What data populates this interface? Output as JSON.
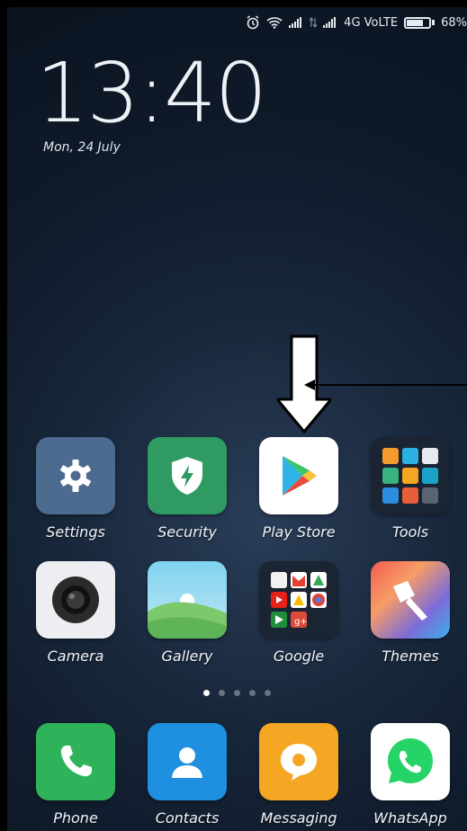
{
  "status_bar": {
    "network_label": "4G VoLTE",
    "battery_percent": "68%"
  },
  "lockclock": {
    "time": "13:40",
    "date": "Mon, 24 July"
  },
  "apps_row1": [
    {
      "label": "Settings",
      "icon": "gear-icon"
    },
    {
      "label": "Security",
      "icon": "shield-icon"
    },
    {
      "label": "Play Store",
      "icon": "play-store-icon"
    },
    {
      "label": "Tools",
      "icon": "tools-folder-icon"
    }
  ],
  "apps_row2": [
    {
      "label": "Camera",
      "icon": "camera-icon"
    },
    {
      "label": "Gallery",
      "icon": "gallery-icon"
    },
    {
      "label": "Google",
      "icon": "google-folder-icon"
    },
    {
      "label": "Themes",
      "icon": "themes-icon"
    }
  ],
  "page_indicator": {
    "pages": 5,
    "current": 1
  },
  "dock": [
    {
      "label": "Phone",
      "icon": "phone-icon"
    },
    {
      "label": "Contacts",
      "icon": "contacts-icon"
    },
    {
      "label": "Messaging",
      "icon": "messaging-icon"
    },
    {
      "label": "WhatsApp",
      "icon": "whatsapp-icon"
    }
  ],
  "colors": {
    "settings_bg": "#4c6b8f",
    "security_bg": "#2f9b62",
    "tools_bg": "#1b2433",
    "gallery_top": "#7fd3f0",
    "gallery_bottom": "#7cc96b",
    "phone_bg": "#2fb35a",
    "contacts_bg": "#1f8fe0",
    "messaging_bg": "#f5a623",
    "whatsapp_bg": "#ffffff"
  }
}
